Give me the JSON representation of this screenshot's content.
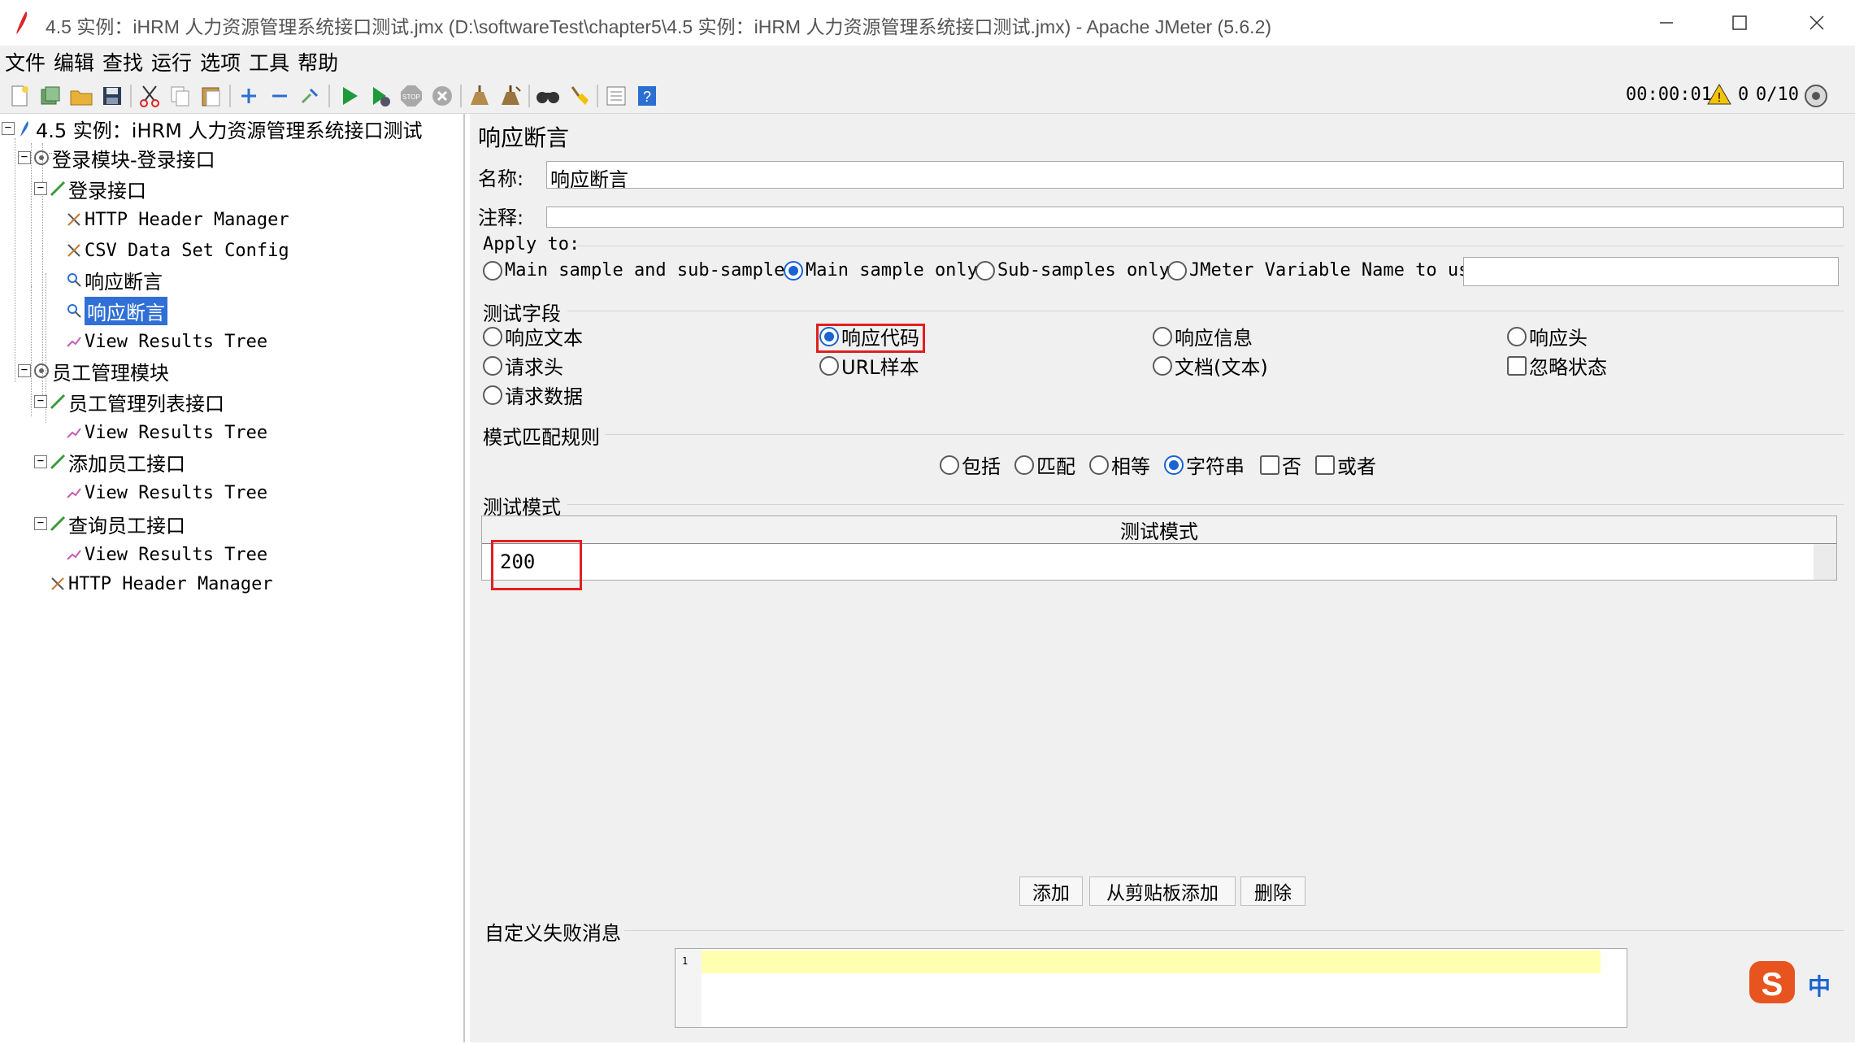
{
  "window": {
    "title": "4.5  实例：iHRM 人力资源管理系统接口测试.jmx (D:\\softwareTest\\chapter5\\4.5  实例：iHRM 人力资源管理系统接口测试.jmx) - Apache JMeter (5.6.2)"
  },
  "menu": [
    "文件",
    "编辑",
    "查找",
    "运行",
    "选项",
    "工具",
    "帮助"
  ],
  "toolbar": {
    "timer": "00:00:01",
    "error_count": "0",
    "threads": "0/10",
    "icons": [
      "new-icon",
      "templates-icon",
      "open-icon",
      "save-icon",
      "cut-icon",
      "copy-icon",
      "paste-icon",
      "expand-icon",
      "collapse-icon",
      "toggle-icon",
      "start-icon",
      "start-no-pause-icon",
      "stop-icon",
      "shutdown-icon",
      "clear-icon",
      "clear-all-icon",
      "search-icon",
      "reset-search-icon",
      "function-helper-icon",
      "help-icon"
    ]
  },
  "tree": {
    "root": "4.5  实例：iHRM 人力资源管理系统接口测试",
    "login_group": "登录模块-登录接口",
    "login_sampler": "登录接口",
    "login_header": "HTTP Header Manager",
    "login_csv": "CSV Data Set Config",
    "login_assert1": "响应断言",
    "login_assert2": "响应断言",
    "login_results": "View Results Tree",
    "emp_group": "员工管理模块",
    "emp_list": "员工管理列表接口",
    "emp_list_results": "View Results Tree",
    "emp_add": "添加员工接口",
    "emp_add_results": "View Results Tree",
    "emp_query": "查询员工接口",
    "emp_query_results": "View Results Tree",
    "emp_header": "HTTP Header Manager"
  },
  "panel": {
    "title": "响应断言",
    "name_label": "名称:",
    "name_value": "响应断言",
    "comment_label": "注释:",
    "comment_value": "",
    "apply_to": {
      "label": "Apply to:",
      "options": [
        "Main sample and sub-samples",
        "Main sample only",
        "Sub-samples only",
        "JMeter Variable Name to use"
      ],
      "selected": "Main sample only",
      "variable_value": ""
    },
    "test_field": {
      "label": "测试字段",
      "options": [
        "响应文本",
        "响应代码",
        "响应信息",
        "响应头",
        "请求头",
        "URL样本",
        "文档(文本)",
        "忽略状态",
        "请求数据"
      ],
      "selected": "响应代码"
    },
    "pattern_rules": {
      "label": "模式匹配规则",
      "radios": [
        "包括",
        "匹配",
        "相等",
        "字符串"
      ],
      "selected": "字符串",
      "checks": [
        "否",
        "或者"
      ]
    },
    "patterns": {
      "label": "测试模式",
      "column_header": "测试模式",
      "rows": [
        "200"
      ]
    },
    "buttons": {
      "add": "添加",
      "add_clipboard": "从剪贴板添加",
      "delete": "删除"
    },
    "custom_message": {
      "label": "自定义失败消息",
      "line_number": "1",
      "value": ""
    }
  },
  "ime": {
    "label": "中"
  },
  "colors": {
    "selection": "#2f6fd6",
    "highlight_box": "#e02020",
    "radio_selected": "#1a63d1",
    "editor_line": "#ffffb0"
  }
}
